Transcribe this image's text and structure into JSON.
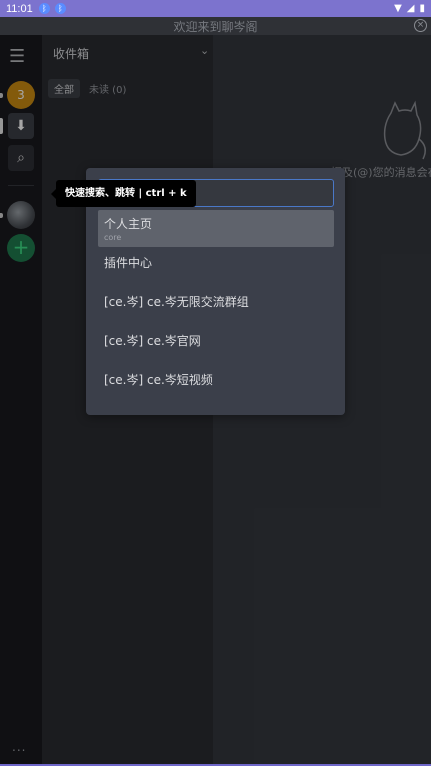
{
  "status_bar": {
    "time": "11:01",
    "notif_icons": [
      "bluetooth-notif-icon",
      "bluetooth-notif-icon"
    ],
    "right_icons": [
      "wifi-icon",
      "signal-icon",
      "battery-icon"
    ]
  },
  "window": {
    "title": "欢迎来到聊岑阁"
  },
  "rail": {
    "server_badge": "3",
    "more": "..."
  },
  "panel": {
    "title": "收件箱",
    "tab_all": "全部",
    "tab_unread": "未读 (0)"
  },
  "main": {
    "hint_text": "提及(@)您的消息会在"
  },
  "tooltip": {
    "text": "快速搜索、跳转 | ctrl + k"
  },
  "switcher": {
    "search_value": "",
    "results": [
      {
        "label": "个人主页",
        "sub": "core"
      },
      {
        "label": "插件中心",
        "sub": ""
      },
      {
        "label": "[ce.岑] ce.岑无限交流群组",
        "sub": ""
      },
      {
        "label": "[ce.岑] ce.岑官网",
        "sub": ""
      },
      {
        "label": "[ce.岑] ce.岑短视频",
        "sub": ""
      }
    ]
  },
  "colors": {
    "accent": "#7c73ce",
    "focus": "#4a78c8",
    "add_green": "#3ddc84",
    "badge_orange": "#c98a12"
  }
}
